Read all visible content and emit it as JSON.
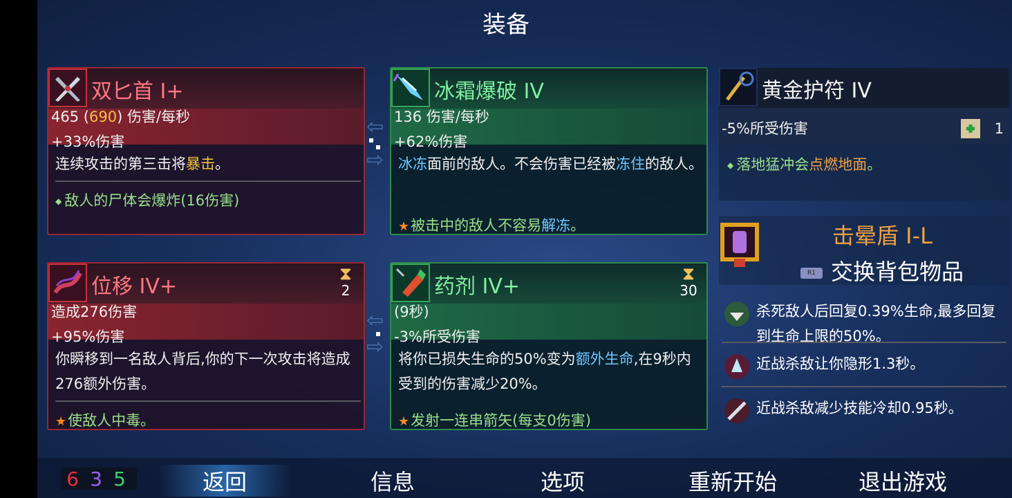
{
  "screen_title": "装备",
  "cards": {
    "twin_daggers": {
      "name": "双匕首 I+",
      "dps_value": "465",
      "dps_paren_open": " (",
      "dps_bonus": "690",
      "dps_paren_close": ") 伤害/每秒",
      "bonus": "+33%伤害",
      "desc_pre": "连续攻击的第三击将",
      "desc_hl": "暴击",
      "desc_post": "。",
      "note": "敌人的尸体会爆炸(16伤害)"
    },
    "ice_blast": {
      "name": "冰霜爆破 IV",
      "dps": "136 伤害/每秒",
      "bonus": "+62%伤害",
      "desc_a": "冰冻",
      "desc_b": "面前的敌人。不会伤害已经被",
      "desc_c": "冻住",
      "desc_d": "的敌人。",
      "note_pre": "被击中的敌人不容易",
      "note_hl": "解冻",
      "note_post": "。"
    },
    "blink": {
      "name": "位移 IV+",
      "charges": "2",
      "line1": "造成276伤害",
      "bonus": "+95%伤害",
      "desc": "你瞬移到一名敌人背后,你的下一次攻击将造成276额外伤害。",
      "note": "使敌人中毒。"
    },
    "potion": {
      "name": "药剂 IV+",
      "charges": "30",
      "line1": "(9秒)",
      "bonus": "-3%所受伤害",
      "desc_pre": "将你已损失生命的50%变为",
      "desc_hl": "额外生命",
      "desc_post": ",在9秒内受到的伤害减少20%。",
      "note": "发射一连串箭矢(每支0伤害)"
    }
  },
  "amulet": {
    "name": "黄金护符 IV",
    "stat": "-5%所受伤害",
    "scroll_count": "1",
    "note_pre": "落地猛冲会",
    "note_hl": "点燃地面",
    "note_post": "。"
  },
  "shield": {
    "name": "击晕盾 I-L",
    "button_hint": "R1",
    "swap_label": "交换背包物品"
  },
  "perks": [
    "杀死敌人后回复0.39%生命,最多回复到生命上限的50%。",
    "近战杀敌让你隐形1.3秒。",
    "近战杀敌减少技能冷却0.95秒。"
  ],
  "counts": {
    "red": "6",
    "purple": "3",
    "green": "5"
  },
  "nav": {
    "back": "返回",
    "info": "信息",
    "options": "选项",
    "restart": "重新开始",
    "quit": "退出游戏"
  },
  "colors": {
    "red_card": "#9a2632",
    "green_card": "#2e8a4c",
    "highlight": "#f0c040",
    "ice": "#70c8ff"
  },
  "icons": [
    "twin-daggers-icon",
    "ice-blast-icon",
    "blink-icon",
    "potion-icon",
    "amulet-icon",
    "scroll-icon",
    "shield-icon",
    "hourglass-icon"
  ]
}
